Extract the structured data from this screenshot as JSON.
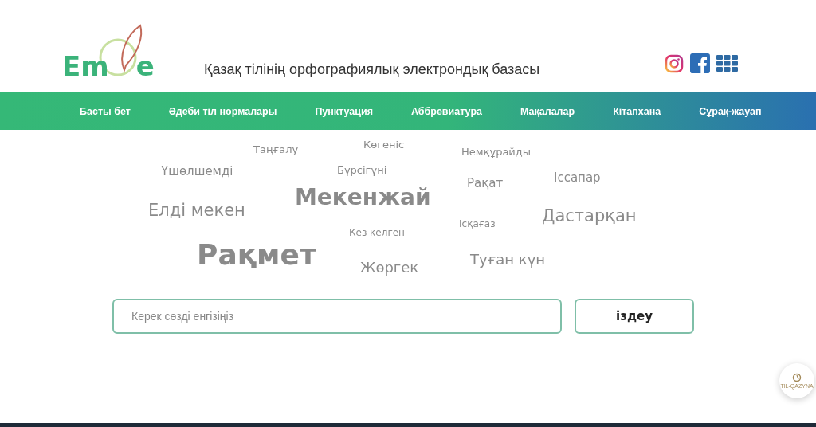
{
  "header": {
    "logo": {
      "left": "Em",
      "right": "e"
    },
    "title": "Қазақ тілінің орфографиялық электрондық базасы"
  },
  "nav": [
    {
      "label": "Басты бет"
    },
    {
      "label": "Әдеби тіл нормалары"
    },
    {
      "label": "Пунктуация"
    },
    {
      "label": "Аббревиатура"
    },
    {
      "label": "Мақалалар"
    },
    {
      "label": "Кітапхана"
    },
    {
      "label": "Сұрақ-жауап"
    }
  ],
  "word_cloud": [
    {
      "text": "Таңғалу",
      "kind": "s"
    },
    {
      "text": "Көгеніс",
      "kind": "s"
    },
    {
      "text": "Немқұрайды",
      "kind": "s"
    },
    {
      "text": "Үшөлшемді",
      "kind": "m"
    },
    {
      "text": "Бүрсігүні",
      "kind": "s"
    },
    {
      "text": "Рақат",
      "kind": "m"
    },
    {
      "text": "Іссапар",
      "kind": "m"
    },
    {
      "text": "Мекенжай",
      "kind": "xl"
    },
    {
      "text": "Елді мекен",
      "kind": "l"
    },
    {
      "text": "Дастарқан",
      "kind": "l"
    },
    {
      "text": "Кез келген",
      "kind": "xs"
    },
    {
      "text": "Іcқағаз",
      "kind": "xs"
    },
    {
      "text": "Рақмет",
      "kind": "xxl"
    },
    {
      "text": "Жөргек",
      "kind": "ml"
    },
    {
      "text": "Туған күн",
      "kind": "ml"
    }
  ],
  "search": {
    "placeholder": "Керек сөзді енгізіңіз",
    "button": "іздеу"
  },
  "badge": {
    "label": "TIL-QAZYNA"
  }
}
